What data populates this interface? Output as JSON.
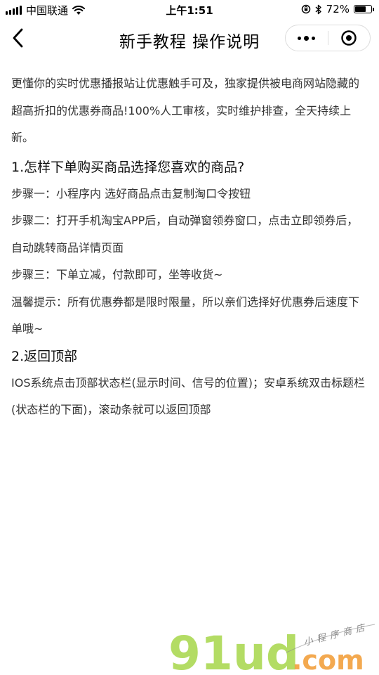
{
  "status_bar": {
    "carrier": "中国联通",
    "time": "上午1:51",
    "battery_percent": "72%",
    "battery_level": 0.72
  },
  "nav": {
    "title": "新手教程 操作说明",
    "back_icon": "chevron-left-icon",
    "more_icon": "more-dots-icon",
    "close_icon": "target-circle-icon"
  },
  "content": {
    "intro": "更懂你的实时优惠播报站让优惠触手可及，独家提供被电商网站隐藏的超高折扣的优惠券商品!100%人工审核，实时维护排查，全天持续上新。",
    "section1": {
      "title": "1.怎样下单购买商品选择您喜欢的商品?",
      "step1": "步骤一：小程序内 选好商品点击复制淘口令按钮",
      "step2": "步骤二：打开手机淘宝APP后，自动弹窗领券窗口，点击立即领券后，自动跳转商品详情页面",
      "step3": "步骤三：下单立减，付款即可，坐等收货~",
      "tip": "温馨提示：所有优惠券都是限时限量，所以亲们选择好优惠券后速度下单哦~"
    },
    "section2": {
      "title": "2.返回顶部",
      "body": "IOS系统点击顶部状态栏(显示时间、信号的位置)；安卓系统双击标题栏(状态栏的下面)，滚动条就可以返回顶部"
    }
  },
  "watermark": {
    "logo_text": "91ud",
    "domain_text": ".com",
    "tagline": "小程序商店",
    "colors": {
      "green": "#a6d64a",
      "orange": "#f29b32",
      "gray": "#8a8a8a"
    }
  }
}
